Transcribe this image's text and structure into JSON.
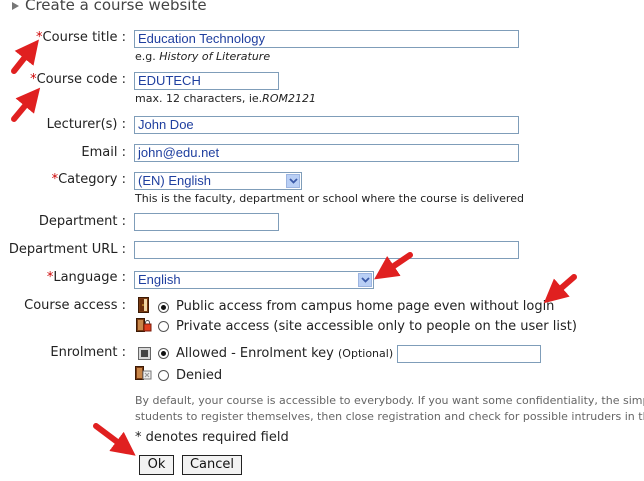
{
  "header": {
    "title": "Create a course website"
  },
  "form": {
    "course_title": {
      "label": "Course title :",
      "value": "Education Technology",
      "hint_prefix": "e.g. ",
      "hint_italic": "History of Literature"
    },
    "course_code": {
      "label": "Course code :",
      "value": "EDUTECH",
      "hint_prefix": "max. 12 characters, ie.",
      "hint_italic": "ROM2121"
    },
    "lecturers": {
      "label": "Lecturer(s) :",
      "value": "John Doe"
    },
    "email": {
      "label": "Email :",
      "value": "john@edu.net"
    },
    "category": {
      "label": "Category :",
      "value": "(EN) English",
      "hint": "This is the faculty, department or school where the course is delivered"
    },
    "department": {
      "label": "Department :",
      "value": ""
    },
    "department_url": {
      "label": "Department URL :",
      "value": ""
    },
    "language": {
      "label": "Language :",
      "value": "English"
    },
    "course_access": {
      "label": "Course access :",
      "public": "Public access from campus home page even without login",
      "private": "Private access (site accessible only to people on the user list)",
      "selected": "public"
    },
    "enrolment": {
      "label": "Enrolment :",
      "allowed": "Allowed - Enrolment key",
      "optional": "(Optional) :",
      "denied": "Denied",
      "key_value": "",
      "selected": "allowed"
    },
    "note_line1": "By default, your course is accessible to everybody. If you want some confidentiality, the simple",
    "note_line2": "students to register themselves, then close registration and check for possible intruders in the",
    "required_star": "*",
    "required_note": "denotes required field",
    "required_marker": "*"
  },
  "buttons": {
    "ok": "Ok",
    "cancel": "Cancel"
  },
  "colors": {
    "required": "#cc0000",
    "annotation_arrow": "#e02020",
    "input_text": "#1f3f9f"
  },
  "icons": [
    "triangle-right-icon",
    "door-open-icon",
    "door-lock-icon",
    "enrolment-allowed-icon",
    "enrolment-denied-icon",
    "dropdown-arrow-icon",
    "red-arrow-icon"
  ]
}
